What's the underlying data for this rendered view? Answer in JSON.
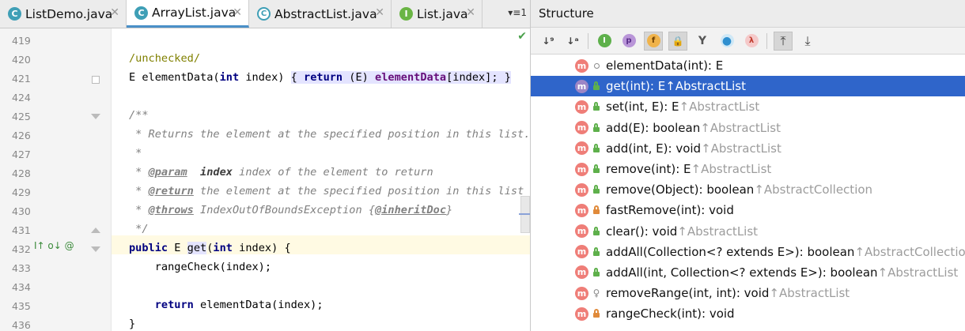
{
  "editor": {
    "tabs": [
      {
        "label": "ListDemo.java",
        "icon": "class-icon"
      },
      {
        "label": "ArrayList.java",
        "icon": "class-icon"
      },
      {
        "label": "AbstractList.java",
        "icon": "abstract-class-icon"
      },
      {
        "label": "List.java",
        "icon": "interface-icon"
      }
    ],
    "tab_menu": "▾≡1",
    "line_numbers": [
      "419",
      "420",
      "421",
      "424",
      "425",
      "426",
      "427",
      "428",
      "429",
      "430",
      "431",
      "432",
      "433",
      "434",
      "435",
      "436"
    ],
    "code": {
      "l420": "/unchecked/",
      "l421_type": "E ",
      "l421_name": "elementData",
      "l421_params_type": "int",
      "l421_params_name": " index) ",
      "l421_body_open": "{ ",
      "l421_return": "return",
      "l421_cast": " (E) ",
      "l421_field": "elementData",
      "l421_tail": "[index]; }",
      "l425": "/**",
      "l426": " * Returns the element at the specified position in this list.",
      "l427": " *",
      "l428_pre": " * ",
      "l428_tag": "@param",
      "l428_mid": "  ",
      "l428_param": "index",
      "l428_rest": " index of the element to return",
      "l429_pre": " * ",
      "l429_tag": "@return",
      "l429_rest": " the element at the specified position in this list",
      "l430_pre": " * ",
      "l430_tag": "@throws",
      "l430_rest": " IndexOutOfBoundsException {",
      "l430_tag2": "@inheritDoc",
      "l430_end": "}",
      "l431": " */",
      "l432_public": "public",
      "l432_type": " E ",
      "l432_name": "get",
      "l432_paren": "(",
      "l432_int": "int",
      "l432_rest": " index) {",
      "l433": "    rangeCheck(index);",
      "l435_return": "return",
      "l435_rest": " elementData(index);",
      "l436": "}"
    },
    "gutter_markers": "I↑ o↓ @"
  },
  "structure": {
    "title": "Structure",
    "toolbar": [
      {
        "icon": "sort-visibility-icon",
        "glyph": "↓⁹"
      },
      {
        "icon": "sort-alpha-icon",
        "glyph": "↓ᵃ"
      },
      {
        "icon": "show-inherited-icon",
        "glyph": "I"
      },
      {
        "icon": "show-properties-icon",
        "glyph": "p"
      },
      {
        "icon": "show-fields-icon",
        "glyph": "f"
      },
      {
        "icon": "show-non-public-icon",
        "glyph": "🔒"
      },
      {
        "icon": "group-methods-icon",
        "glyph": "Y"
      },
      {
        "icon": "show-anonymous-icon",
        "glyph": "●"
      },
      {
        "icon": "show-lambdas-icon",
        "glyph": "λ"
      },
      {
        "icon": "autoscroll-to-source-icon",
        "glyph": "⤒"
      },
      {
        "icon": "autoscroll-from-source-icon",
        "glyph": "⤓"
      }
    ],
    "items": [
      {
        "name": "elementData(int): E",
        "inherited": "",
        "visibility": "package"
      },
      {
        "name": "get(int): E ",
        "inherited": "↑AbstractList",
        "visibility": "public",
        "selected": true
      },
      {
        "name": "set(int, E): E ",
        "inherited": "↑AbstractList",
        "visibility": "public"
      },
      {
        "name": "add(E): boolean ",
        "inherited": "↑AbstractList",
        "visibility": "public"
      },
      {
        "name": "add(int, E): void ",
        "inherited": "↑AbstractList",
        "visibility": "public"
      },
      {
        "name": "remove(int): E ",
        "inherited": "↑AbstractList",
        "visibility": "public"
      },
      {
        "name": "remove(Object): boolean ",
        "inherited": "↑AbstractCollection",
        "visibility": "public"
      },
      {
        "name": "fastRemove(int): void",
        "inherited": "",
        "visibility": "private"
      },
      {
        "name": "clear(): void ",
        "inherited": "↑AbstractList",
        "visibility": "public"
      },
      {
        "name": "addAll(Collection<? extends E>): boolean ",
        "inherited": "↑AbstractCollection",
        "visibility": "public"
      },
      {
        "name": "addAll(int, Collection<? extends E>): boolean ",
        "inherited": "↑AbstractList",
        "visibility": "public"
      },
      {
        "name": "removeRange(int, int): void ",
        "inherited": "↑AbstractList",
        "visibility": "protected"
      },
      {
        "name": "rangeCheck(int): void",
        "inherited": "",
        "visibility": "private"
      }
    ]
  },
  "colors": {
    "selection": "#2f65ca",
    "method_icon": "#ef7e78",
    "keyword": "#000080",
    "comment": "#808080"
  }
}
